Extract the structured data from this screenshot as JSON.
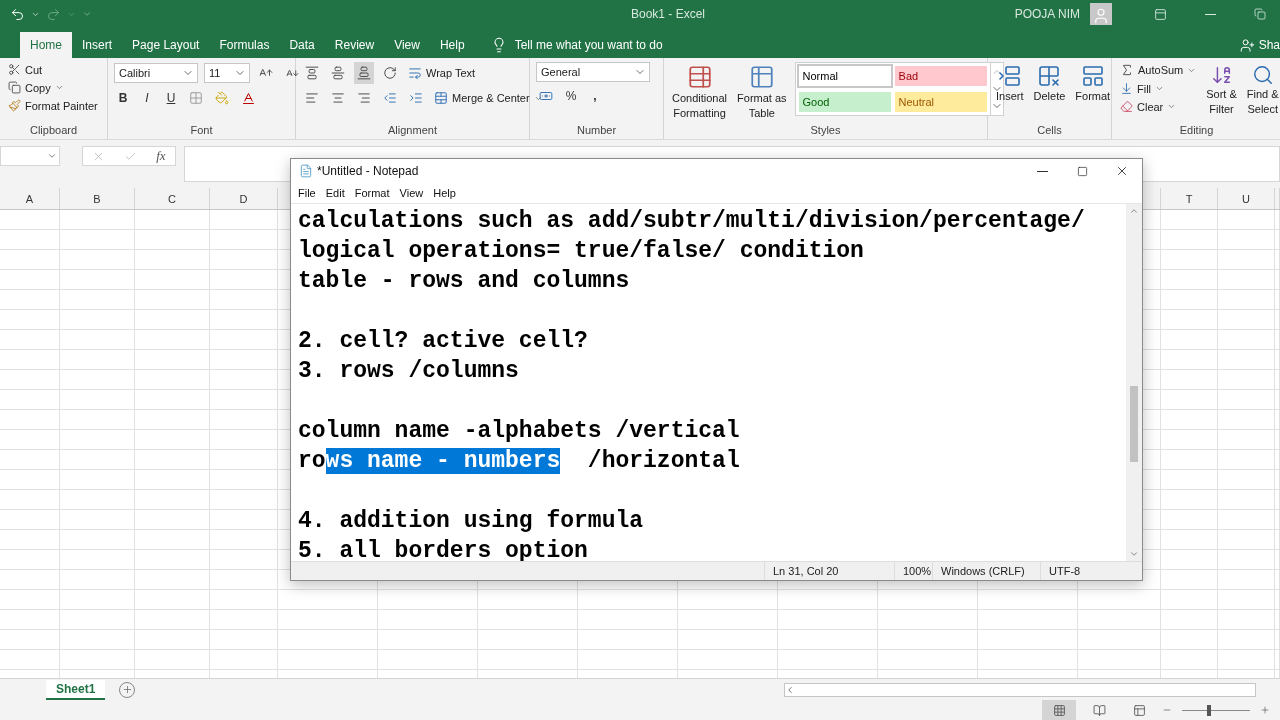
{
  "title_bar": {
    "title": "Book1 - Excel",
    "user": "POOJA NIM"
  },
  "ribbon_tabs": [
    {
      "label": "Home",
      "selected": true
    },
    {
      "label": "Insert",
      "selected": false
    },
    {
      "label": "Page Layout",
      "selected": false
    },
    {
      "label": "Formulas",
      "selected": false
    },
    {
      "label": "Data",
      "selected": false
    },
    {
      "label": "Review",
      "selected": false
    },
    {
      "label": "View",
      "selected": false
    },
    {
      "label": "Help",
      "selected": false
    }
  ],
  "tell_me": {
    "placeholder": "Tell me what you want to do"
  },
  "share": "Sha",
  "clipboard": {
    "label": "Clipboard",
    "cut": "Cut",
    "copy": "Copy",
    "painter": "Format Painter"
  },
  "font": {
    "label": "Font",
    "name": "Calibri",
    "size": "11",
    "bold": "B",
    "italic": "I",
    "underline": "U"
  },
  "alignment": {
    "label": "Alignment",
    "wrap": "Wrap Text",
    "merge": "Merge & Center"
  },
  "number": {
    "label": "Number",
    "format": "General",
    "percent": "%",
    "comma": ","
  },
  "styles": {
    "label": "Styles",
    "conditional": [
      "Conditional",
      "Formatting"
    ],
    "format_table": [
      "Format as",
      "Table"
    ],
    "cell_styles": [
      {
        "name": "Normal",
        "color": "#ffffff"
      },
      {
        "name": "Bad",
        "color": "#ffc7ce"
      },
      {
        "name": "Good",
        "color": "#c6efce"
      },
      {
        "name": "Neutral",
        "color": "#ffeb9c"
      }
    ]
  },
  "cells": {
    "label": "Cells",
    "buttons": [
      "Insert",
      "Delete",
      "Format"
    ]
  },
  "editing": {
    "label": "Editing",
    "autosum": "AutoSum",
    "fill": "Fill",
    "clear": "Clear",
    "sort": [
      "Sort &",
      "Filter"
    ],
    "find": [
      "Find &",
      "Select"
    ]
  },
  "formula_bar": {
    "fx": "fx"
  },
  "columns_left": [
    "A",
    "B",
    "C",
    "D"
  ],
  "columns_right": [
    "T",
    "U"
  ],
  "sheet_tabs": [
    {
      "label": "Sheet1",
      "selected": true
    }
  ],
  "zoom": {
    "level": 0.4
  },
  "notepad": {
    "title": "*Untitled - Notepad",
    "menu": [
      "File",
      "Edit",
      "Format",
      "View",
      "Help"
    ],
    "lines": [
      {
        "kind": "text",
        "text": "calculations such as add/subtr/multi/division/percentage/"
      },
      {
        "kind": "text",
        "text": "logical operations= true/false/ condition"
      },
      {
        "kind": "text",
        "text": "table - rows and columns"
      },
      {
        "kind": "blank"
      },
      {
        "kind": "text",
        "text": "2. cell? active cell?"
      },
      {
        "kind": "text",
        "text": "3. rows /columns"
      },
      {
        "kind": "blank"
      },
      {
        "kind": "text",
        "text": "column name -alphabets /vertical"
      },
      {
        "kind": "selection",
        "before": "ro",
        "selected": "ws name - numbers",
        "after": "  /horizontal"
      },
      {
        "kind": "blank"
      },
      {
        "kind": "text",
        "text": "4. addition using formula"
      },
      {
        "kind": "text",
        "text": "5. all borders option"
      }
    ],
    "status": [
      "Ln 31, Col 20",
      "100%",
      "Windows (CRLF)",
      "UTF-8"
    ]
  }
}
